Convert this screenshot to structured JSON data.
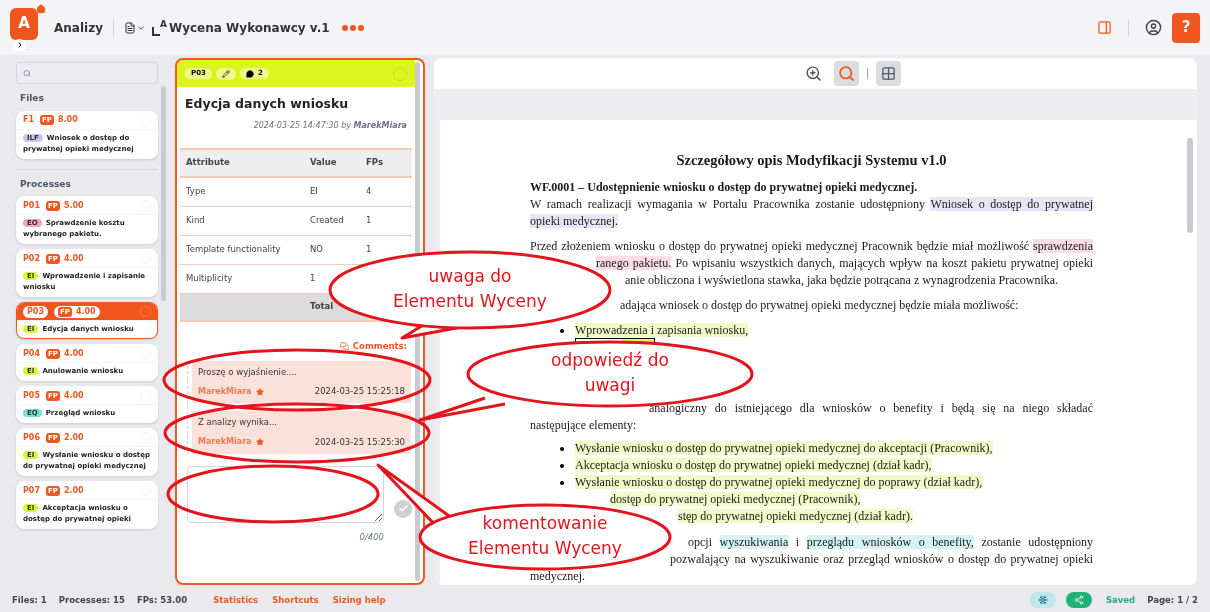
{
  "header": {
    "logo_letter": "A",
    "app_name": "Analizy",
    "title_icon_letter": "A",
    "title": "Wycena Wykonawcy v.1",
    "help_label": "?"
  },
  "sidebar": {
    "sections": [
      {
        "title": "Files",
        "items": [
          {
            "code": "F1",
            "fp_label": "FP",
            "fp": "8.00",
            "type": "ILF",
            "color": "#c9c4f2",
            "name": "Wniosek o dostęp do prywatnej opieki medycznej",
            "selected": false
          }
        ]
      },
      {
        "title": "Processes",
        "items": [
          {
            "code": "P01",
            "fp_label": "FP",
            "fp": "5.00",
            "type": "EO",
            "color": "#f2a3b6",
            "name": "Sprawdzenie kosztu wybranego pakietu.",
            "selected": false
          },
          {
            "code": "P02",
            "fp_label": "FP",
            "fp": "4.00",
            "type": "EI",
            "color": "#d9f53a",
            "name": "Wprowadzenie i zapisanie wniosku",
            "selected": false
          },
          {
            "code": "P03",
            "fp_label": "FP",
            "fp": "4.00",
            "type": "EI",
            "color": "#d9f53a",
            "name": "Edycja danych wniosku",
            "selected": true
          },
          {
            "code": "P04",
            "fp_label": "FP",
            "fp": "4.00",
            "type": "EI",
            "color": "#d9f53a",
            "name": "Anulowanie wniosku",
            "selected": false
          },
          {
            "code": "P05",
            "fp_label": "FP",
            "fp": "4.00",
            "type": "EQ",
            "color": "#6fe3d3",
            "name": "Przegląd wniosku",
            "selected": false
          },
          {
            "code": "P06",
            "fp_label": "FP",
            "fp": "2.00",
            "type": "EI",
            "color": "#d9f53a",
            "name": "Wysłanie wniosku o dostęp do prywatnej opieki medycznej",
            "selected": false
          },
          {
            "code": "P07",
            "fp_label": "FP",
            "fp": "2.00",
            "type": "EI",
            "color": "#d9f53a",
            "name": "Akceptacja wniosku o dostęp do prywatnej opieki",
            "selected": false
          }
        ]
      }
    ]
  },
  "panel": {
    "code": "P03",
    "comment_count": "2",
    "title": "Edycja danych wniosku",
    "meta": "2024-03-25 14:47:30 by **MarekMiara**",
    "table": {
      "columns": [
        "Attribute",
        "Value",
        "FPs"
      ],
      "rows": [
        [
          "Type",
          "EI",
          "4"
        ],
        [
          "Kind",
          "Created",
          "1"
        ],
        [
          "Template functionality",
          "NO",
          "1"
        ],
        [
          "Multiplicity",
          "1"
        ]
      ],
      "total_label": "Total"
    },
    "comments_label": "Comments:",
    "comments": [
      {
        "text": "Proszę o wyjaśnienie....",
        "author": "MarekMiara",
        "date": "2024-03-25 15:25:18"
      },
      {
        "text": "Z analizy wynika...",
        "author": "MarekMiara",
        "date": "2024-03-25 15:25:30"
      }
    ],
    "counter": "0/400"
  },
  "viewer": {
    "tools": [
      {
        "kind": "zoom",
        "selected": false
      },
      {
        "kind": "area_zoom",
        "selected": true
      },
      {
        "kind": "grid",
        "selected": true
      }
    ],
    "document": {
      "title": "Szczegółowy opis Modyfikacji Systemu v1.0",
      "paragraphs": [
        {
          "lines": [
            {
              "kind": "bold",
              "segments": [
                {
                  "text": "WF.0001 – Udostępnienie wniosku o dostęp do prywatnej opieki medycznej."
                }
              ]
            },
            {
              "kind": "justify",
              "segments": [
                {
                  "text": "W ramach realizacji wymagania w Portalu Pracownika zostanie udostępniony "
                },
                {
                  "text": "Wniosek o dostęp do prywatnej",
                  "color": "#e6e6f6"
                }
              ]
            },
            {
              "kind": "last",
              "segments": [
                {
                  "text": "opieki medycznej.",
                  "color": "#e6e6f6"
                }
              ]
            }
          ]
        },
        {
          "lines": [
            {
              "kind": "justify",
              "segments": [
                {
                  "text": "Przed złożeniem wniosku o dostęp do prywatnej opieki medycznej Pracownik będzie miał możliwość "
                },
                {
                  "text": "sprawdzenia",
                  "color": "#f8dde4"
                }
              ]
            },
            {
              "kind": "justify",
              "segments": [
                {
                  "text": "ranego pakietu.",
                  "color": "#f8dde4"
                },
                {
                  "text": " Po wpisaniu wszystkich danych, mających wpływ na koszt pakietu prywatnej opieki"
                }
              ]
            },
            {
              "kind": "last",
              "segments": [
                {
                  "text": "anie obliczona i wyświetlona stawka, jaka będzie potrącana z wynagrodzenia Pracownika."
                }
              ]
            }
          ]
        },
        {
          "lines": [
            {
              "kind": "last",
              "segments": [
                {
                  "text": "adająca wniosek o dostęp do prywatnej opieki medycznej będzie miała możliwość:"
                }
              ]
            }
          ]
        },
        {
          "lines": [
            {
              "kind": "bullet",
              "segments": [
                {
                  "text": "Wprowadzenia i zapisania wniosku,",
                  "color": "#f1fbc8"
                }
              ]
            },
            {
              "kind": "boxed"
            }
          ]
        },
        {
          "lines": [
            {
              "kind": "justify",
              "segments": [
                {
                  "text": "analogiczny do istniejącego dla wniosków o benefity i będą się na niego składać"
                }
              ]
            },
            {
              "kind": "last",
              "segments": [
                {
                  "text": "następujące elementy:"
                }
              ]
            }
          ]
        },
        {
          "lines": [
            {
              "kind": "bullet",
              "segments": [
                {
                  "text": "Wysłanie wniosku o dostęp do prywatnej opieki medycznej do akceptacji (Pracownik),",
                  "color": "#f1fbc8"
                }
              ]
            },
            {
              "kind": "bullet",
              "segments": [
                {
                  "text": "Akceptacja wniosku o dostęp do prywatnej opieki medycznej (dział kadr),",
                  "color": "#f1fbc8"
                }
              ]
            },
            {
              "kind": "bullet",
              "segments": [
                {
                  "text": "Wysłanie wniosku o dostęp do prywatnej opieki medycznej do poprawy (dział kadr),",
                  "color": "#f1fbc8"
                }
              ]
            },
            {
              "kind": "bullet",
              "segments": [
                {
                  "text": "dostęp do prywatnej opieki medycznej (Pracownik),",
                  "color": "#f1fbc8"
                }
              ]
            },
            {
              "kind": "bullet",
              "segments": [
                {
                  "text": "stęp do prywatnej opieki medycznej (dział kadr).",
                  "color": "#f1fbc8"
                }
              ]
            }
          ]
        },
        {
          "lines": [
            {
              "kind": "justify",
              "segments": [
                {
                  "text": "opcji "
                },
                {
                  "text": "wyszukiwania",
                  "color": "#d6f3f3"
                },
                {
                  "text": " i "
                },
                {
                  "text": "przeglądu wniosków o benefity,",
                  "color": "#d6f3f3"
                },
                {
                  "text": " zostanie udostępniony"
                }
              ]
            },
            {
              "kind": "justify",
              "segments": [
                {
                  "text": "pozwalający na wyszukiwanie oraz przegląd wniosków o dostęp do prywatnej opieki"
                }
              ]
            },
            {
              "kind": "last",
              "segments": [
                {
                  "text": "medycznej."
                }
              ]
            }
          ]
        }
      ]
    }
  },
  "annotations": [
    {
      "kind": "bubble",
      "lines": [
        "uwaga do",
        "Elementu Wyceny"
      ]
    },
    {
      "kind": "bubble",
      "lines": [
        "odpowiedź do",
        "uwagi"
      ]
    },
    {
      "kind": "bubble",
      "lines": [
        "komentowanie",
        "Elementu Wyceny"
      ]
    },
    {
      "kind": "ring"
    },
    {
      "kind": "ring"
    },
    {
      "kind": "ring"
    }
  ],
  "status_bar": {
    "stats": [
      "Files: 1",
      "Processes: 15",
      "FPs: 53.00"
    ],
    "links": [
      "Statistics",
      "Shortcuts",
      "Sizing help"
    ],
    "saved": "Saved",
    "page": "Page: 1 / 2"
  }
}
